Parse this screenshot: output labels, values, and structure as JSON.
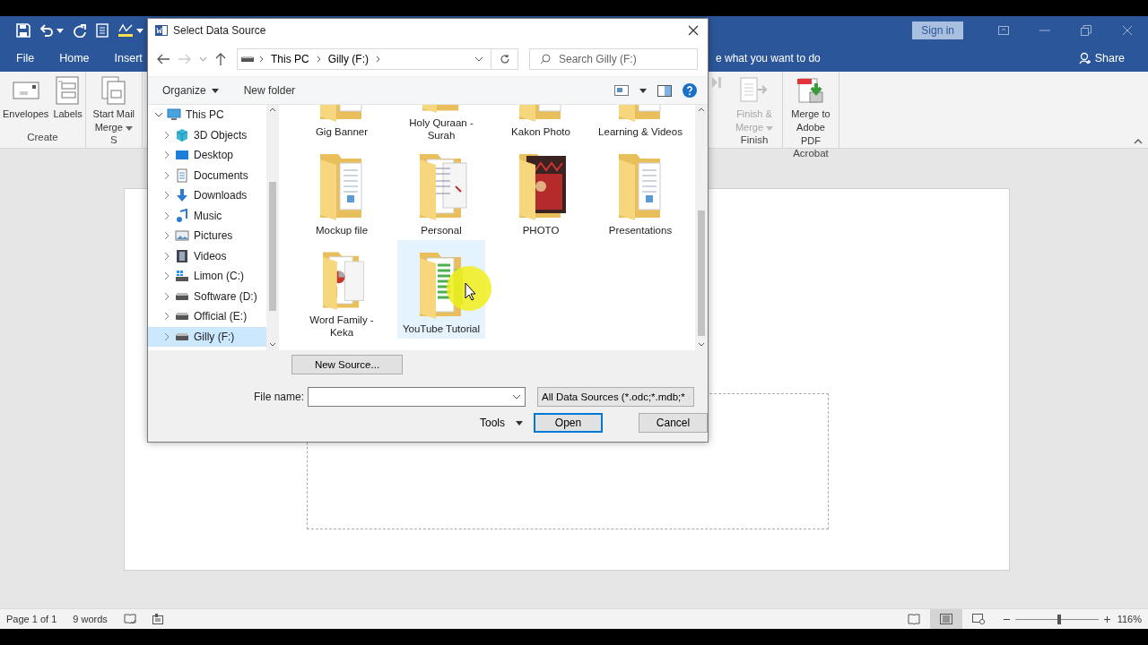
{
  "word": {
    "tabs": [
      {
        "label": "File",
        "selected": false
      },
      {
        "label": "Home",
        "selected": false
      },
      {
        "label": "Insert",
        "selected": false
      }
    ],
    "tell_me": "e what you want to do",
    "sign_in": "Sign in",
    "share": "Share",
    "ribbon": {
      "left_groups": [
        {
          "label": "Create",
          "items": [
            {
              "label": "Envelopes",
              "kind": "envelope",
              "disabled": false,
              "dropdown": false
            },
            {
              "label": "Labels",
              "kind": "labels",
              "disabled": false,
              "dropdown": false
            }
          ]
        },
        {
          "label": "S",
          "items": [
            {
              "label": "Start Mail Merge",
              "kind": "mail-merge",
              "disabled": false,
              "dropdown": true
            }
          ]
        }
      ],
      "right_groups": [
        {
          "label": "Finish",
          "items": [
            {
              "label": "Finish & Merge",
              "kind": "finish",
              "disabled": true,
              "dropdown": true
            }
          ]
        },
        {
          "label": "Acrobat",
          "items": [
            {
              "label": "Merge to Adobe PDF",
              "kind": "pdf",
              "disabled": false,
              "dropdown": false
            }
          ]
        }
      ]
    },
    "status": {
      "page": "Page 1 of 1",
      "words": "9 words",
      "views": [
        {
          "kind": "read",
          "selected": false
        },
        {
          "kind": "print",
          "selected": true
        },
        {
          "kind": "web",
          "selected": false
        }
      ],
      "zoom": {
        "level": 0.53
      },
      "zoom_reading": "116%"
    }
  },
  "dialog": {
    "title": "Select Data Source",
    "breadcrumb": [
      "This PC",
      "Gilly (F:)"
    ],
    "search_placeholder": "Search Gilly (F:)",
    "organize": "Organize",
    "new_folder": "New folder",
    "tree": [
      {
        "label": "This PC",
        "kind": "pc",
        "expanded": true,
        "selected": false,
        "children": [
          {
            "label": "3D Objects",
            "kind": "cube",
            "expanded": false,
            "selected": false
          },
          {
            "label": "Desktop",
            "kind": "desktop",
            "expanded": false,
            "selected": false
          },
          {
            "label": "Documents",
            "kind": "documents",
            "expanded": false,
            "selected": false
          },
          {
            "label": "Downloads",
            "kind": "downloads",
            "expanded": false,
            "selected": false
          },
          {
            "label": "Music",
            "kind": "music",
            "expanded": false,
            "selected": false
          },
          {
            "label": "Pictures",
            "kind": "pictures",
            "expanded": false,
            "selected": false
          },
          {
            "label": "Videos",
            "kind": "videos",
            "expanded": false,
            "selected": false
          },
          {
            "label": "Limon (C:)",
            "kind": "system-drive",
            "expanded": false,
            "selected": false
          },
          {
            "label": "Software (D:)",
            "kind": "drive",
            "expanded": false,
            "selected": false
          },
          {
            "label": "Official (E:)",
            "kind": "drive",
            "expanded": false,
            "selected": false
          },
          {
            "label": "Gilly (F:)",
            "kind": "drive",
            "expanded": false,
            "selected": true
          }
        ]
      }
    ],
    "files": [
      {
        "name": "Gig Banner",
        "kind": "docs",
        "selected": false
      },
      {
        "name": "Holy Quraan - Surah",
        "kind": "docs",
        "selected": false
      },
      {
        "name": "Kakon Photo",
        "kind": "docs",
        "selected": false
      },
      {
        "name": "Learning & Videos",
        "kind": "docs",
        "selected": false
      },
      {
        "name": "Mockup file",
        "kind": "docs",
        "selected": false
      },
      {
        "name": "Personal",
        "kind": "report",
        "selected": false
      },
      {
        "name": "PHOTO",
        "kind": "photo",
        "selected": false
      },
      {
        "name": "Presentations",
        "kind": "docs",
        "selected": false
      },
      {
        "name": "Word Family - Keka",
        "kind": "chart",
        "selected": false
      },
      {
        "name": "YouTube Tutorial",
        "kind": "sheet",
        "selected": true
      }
    ],
    "new_source": "New Source...",
    "file_name_label": "File name:",
    "filter": "All Data Sources (*.odc;*.mdb;*",
    "tools": "Tools",
    "open": "Open",
    "cancel": "Cancel"
  }
}
